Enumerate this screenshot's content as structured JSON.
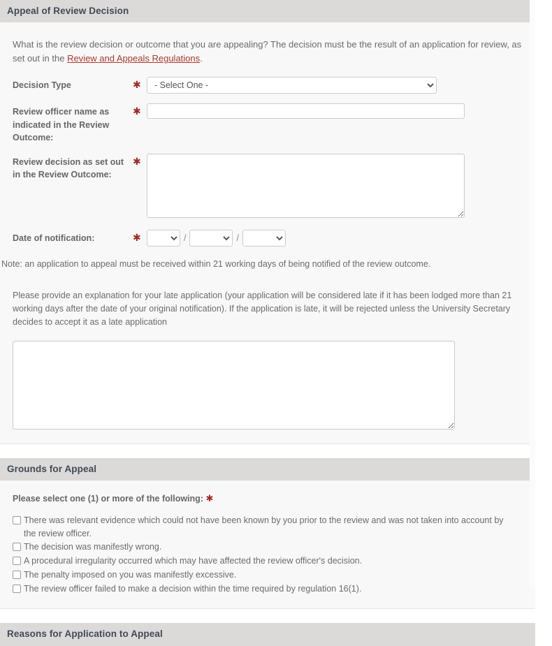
{
  "sections": {
    "appeal": {
      "header": "Appeal of Review Decision",
      "intro_before": "What is the review decision or outcome that you are appealing? The decision must be the result of an application for review, as set out in the ",
      "intro_link": "Review and Appeals Regulations",
      "intro_after": ".",
      "fields": {
        "decision_type": {
          "label": "Decision Type",
          "required_mark": "✱",
          "selected": "- Select One -"
        },
        "review_officer": {
          "label": "Review officer name as indicated in the Review Outcome:",
          "required_mark": "✱",
          "value": "",
          "placeholder": ""
        },
        "review_decision": {
          "label": "Review decision as set out in the Review Outcome:",
          "required_mark": "✱",
          "value": "",
          "placeholder": ""
        },
        "date_of_notification": {
          "label": "Date of notification:",
          "required_mark": "✱",
          "day": "",
          "month": "",
          "year": "",
          "separator": "/"
        }
      },
      "note": "Note: an application to appeal must be received within 21 working days of being notified of the review outcome.",
      "late_application": {
        "text": "Please provide an explanation for your late application (your application will be considered late if it has been lodged more than 21 working days after the date of your original notification). If the application is late, it will be rejected unless the University Secretary decides to accept it as a late application",
        "value": "",
        "placeholder": ""
      }
    },
    "grounds": {
      "header": "Grounds for Appeal",
      "prompt": "Please select one (1) or more of the following:",
      "required_mark": "✱",
      "options": [
        {
          "label": "There was relevant evidence which could not have been known by you prior to the review and was not taken into account by the review officer.",
          "checked": false
        },
        {
          "label": "The decision was manifestly wrong.",
          "checked": false
        },
        {
          "label": "A procedural irregularity occurred which may have affected the review officer's decision.",
          "checked": false
        },
        {
          "label": "The penalty imposed on you was manifestly excessive.",
          "checked": false
        },
        {
          "label": "The review officer failed to make a decision within the time required by regulation 16(1).",
          "checked": false
        }
      ]
    },
    "reasons": {
      "header": "Reasons for Application to Appeal"
    }
  },
  "colors": {
    "panel_header_bg": "#dcd9d9",
    "panel_body_bg": "#f8f8f8",
    "required_asterisk": "#9e2b25",
    "link": "#a43a2e",
    "heading_text": "#3f4a54",
    "body_text": "#6b6b6b"
  }
}
